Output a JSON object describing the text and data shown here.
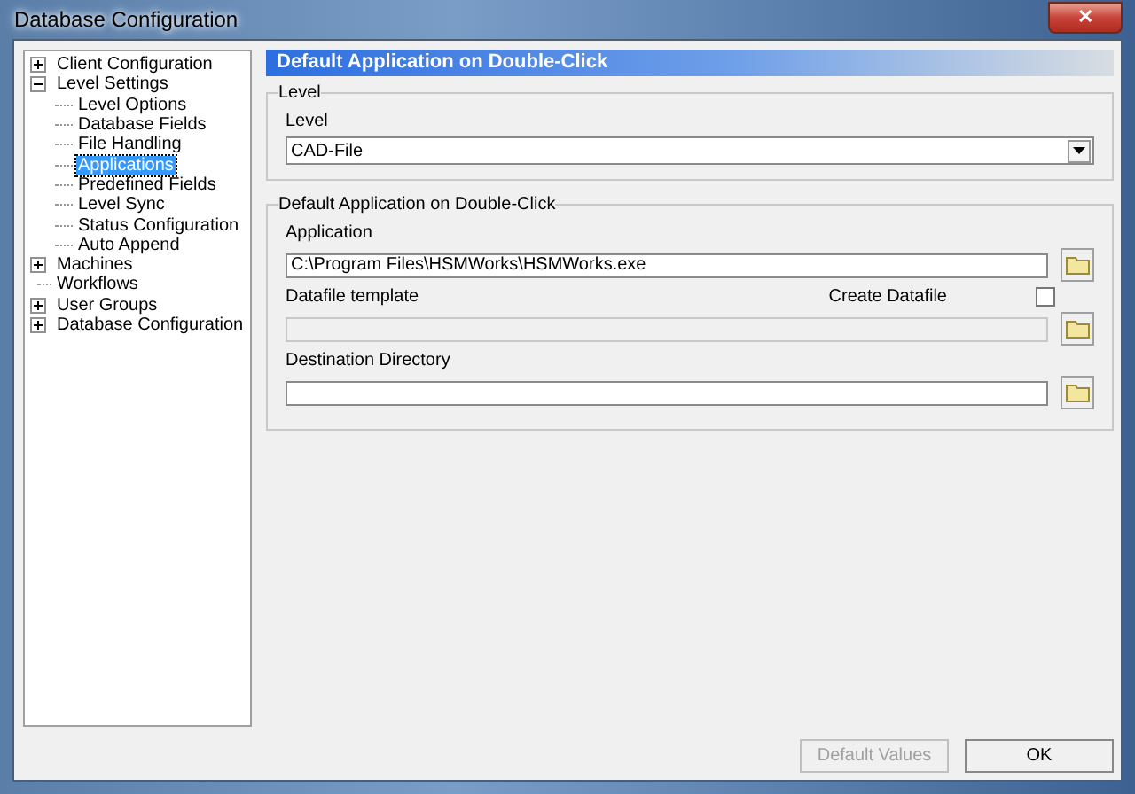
{
  "window": {
    "title": "Database Configuration",
    "close": "✕"
  },
  "tree": [
    {
      "label": "Client Configuration",
      "kind": "node",
      "expanded": false,
      "selected": false
    },
    {
      "label": "Level Settings",
      "kind": "node",
      "expanded": true,
      "selected": false,
      "children": [
        {
          "label": "Level Options",
          "selected": false
        },
        {
          "label": "Database Fields",
          "selected": false
        },
        {
          "label": "File Handling",
          "selected": false
        },
        {
          "label": "Applications",
          "selected": true
        },
        {
          "label": "Predefined Fields",
          "selected": false
        },
        {
          "label": "Level Sync",
          "selected": false
        },
        {
          "label": "Status Configuration",
          "selected": false
        },
        {
          "label": "Auto Append",
          "selected": false
        }
      ]
    },
    {
      "label": "Machines",
      "kind": "node",
      "expanded": false,
      "selected": false
    },
    {
      "label": "Workflows",
      "kind": "leaf",
      "selected": false
    },
    {
      "label": "User Groups",
      "kind": "node",
      "expanded": false,
      "selected": false
    },
    {
      "label": "Database Configuration",
      "kind": "node",
      "expanded": false,
      "selected": false
    }
  ],
  "panel": {
    "title": "Default Application on Double-Click",
    "level_group": {
      "legend": "Level",
      "label": "Level",
      "value": "CAD-File"
    },
    "app_group": {
      "legend": "Default Application on Double-Click",
      "application": {
        "label": "Application",
        "value": "C:\\Program Files\\HSMWorks\\HSMWorks.exe",
        "disabled": false
      },
      "datafile_template": {
        "label": "Datafile template",
        "disabled": true
      },
      "create_datafile": {
        "label": "Create Datafile",
        "checked": false
      },
      "destination": {
        "label": "Destination Directory",
        "disabled": false
      }
    }
  },
  "buttons": [
    {
      "label": "Default Values",
      "disabled": true
    },
    {
      "label": "OK",
      "disabled": false
    }
  ]
}
